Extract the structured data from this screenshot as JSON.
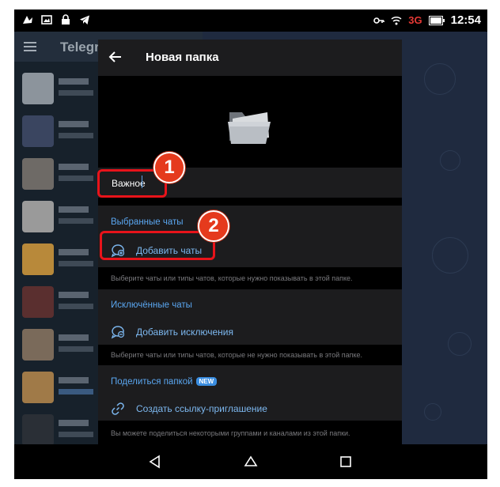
{
  "status_bar": {
    "network": "3G",
    "time": "12:54"
  },
  "background": {
    "app_title": "Telegra"
  },
  "panel": {
    "title": "Новая папка",
    "folder_name": "Важное",
    "included": {
      "title": "Выбранные чаты",
      "action": "Добавить чаты",
      "hint": "Выберите чаты или типы чатов, которые нужно показывать в этой папке."
    },
    "excluded": {
      "title": "Исключённые чаты",
      "action": "Добавить исключения",
      "hint": "Выберите чаты или типы чатов, которые не нужно показывать в этой папке."
    },
    "share": {
      "title": "Поделиться папкой",
      "badge": "NEW",
      "action": "Создать ссылку-приглашение",
      "hint": "Вы можете поделиться некоторыми группами и каналами из этой папки."
    }
  },
  "annotations": {
    "step1": "1",
    "step2": "2"
  },
  "colors": {
    "accent": "#5aa6f0",
    "annotation_red": "#e8131a",
    "panel_bg": "#1c1c1e"
  }
}
